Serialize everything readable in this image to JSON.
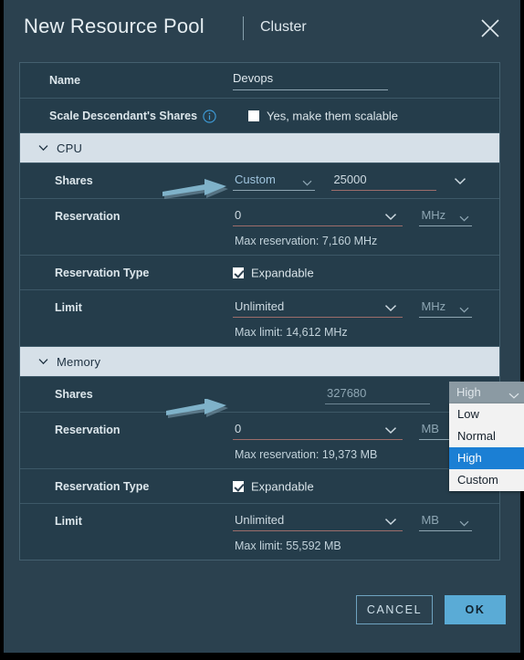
{
  "dialog": {
    "title": "New Resource Pool",
    "subtitle": "Cluster",
    "close_icon": "close-icon"
  },
  "form": {
    "name": {
      "label": "Name",
      "value": "Devops"
    },
    "scale_shares": {
      "label": "Scale Descendant's Shares",
      "info_icon": "info-icon",
      "checkbox_label": "Yes, make them scalable",
      "checked": false
    },
    "sections": [
      {
        "id": "cpu",
        "title": "CPU",
        "expanded": true,
        "rows": {
          "shares": {
            "label": "Shares",
            "select_value": "Custom",
            "number_value": "25000"
          },
          "reservation": {
            "label": "Reservation",
            "value": "0",
            "unit": "MHz",
            "hint": "Max reservation: 7,160 MHz"
          },
          "reservation_type": {
            "label": "Reservation Type",
            "checkbox_label": "Expandable",
            "checked": true
          },
          "limit": {
            "label": "Limit",
            "value": "Unlimited",
            "unit": "MHz",
            "hint": "Max limit: 14,612 MHz"
          }
        }
      },
      {
        "id": "memory",
        "title": "Memory",
        "expanded": true,
        "rows": {
          "shares": {
            "label": "Shares",
            "select_value": "High",
            "number_value": "327680",
            "dropdown_open": true,
            "options": [
              "Low",
              "Normal",
              "High",
              "Custom"
            ],
            "selected_option": "High"
          },
          "reservation": {
            "label": "Reservation",
            "value": "0",
            "unit": "MB",
            "hint": "Max reservation: 19,373 MB"
          },
          "reservation_type": {
            "label": "Reservation Type",
            "checkbox_label": "Expandable",
            "checked": true
          },
          "limit": {
            "label": "Limit",
            "value": "Unlimited",
            "unit": "MB",
            "hint": "Max limit: 55,592 MB"
          }
        }
      }
    ]
  },
  "footer": {
    "cancel_label": "CANCEL",
    "ok_label": "OK"
  },
  "annotations": {
    "arrow_color": "#7fb2c9",
    "arrow_cpu_shares": "arrow-pointing-to-cpu-shares",
    "arrow_memory_shares": "arrow-pointing-to-memory-shares"
  },
  "colors": {
    "dialog_bg": "#2b414f",
    "card_bg": "#253d4b",
    "section_header_bg": "#d6e0e8",
    "accent": "#5aabd6",
    "dropdown_highlight": "#1b7fd4"
  }
}
